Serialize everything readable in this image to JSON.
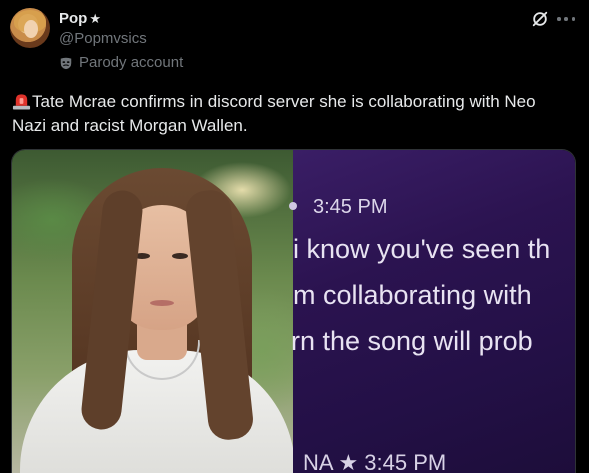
{
  "author": {
    "display_name": "Pop",
    "display_name_glyph": "★",
    "handle": "@Popmvsics",
    "parody_label": "Parody account"
  },
  "tweet": {
    "emoji": "siren",
    "text": "Tate Mcrae confirms in discord server she is collaborating with Neo Nazi and racist Morgan Wallen."
  },
  "media": {
    "discord": {
      "time": "3:45 PM",
      "line1": "i know you've seen th",
      "line2": "m collaborating with",
      "line3": "rn the song will prob",
      "bottom_partial": "NA ★ 3:45 PM"
    }
  },
  "icons": {
    "grok": "grok-icon",
    "more": "more-icon",
    "mask": "mask-icon"
  },
  "colors": {
    "background": "#000000",
    "text_primary": "#e7e9ea",
    "text_secondary": "#71767b",
    "siren_red": "#e0332b"
  }
}
